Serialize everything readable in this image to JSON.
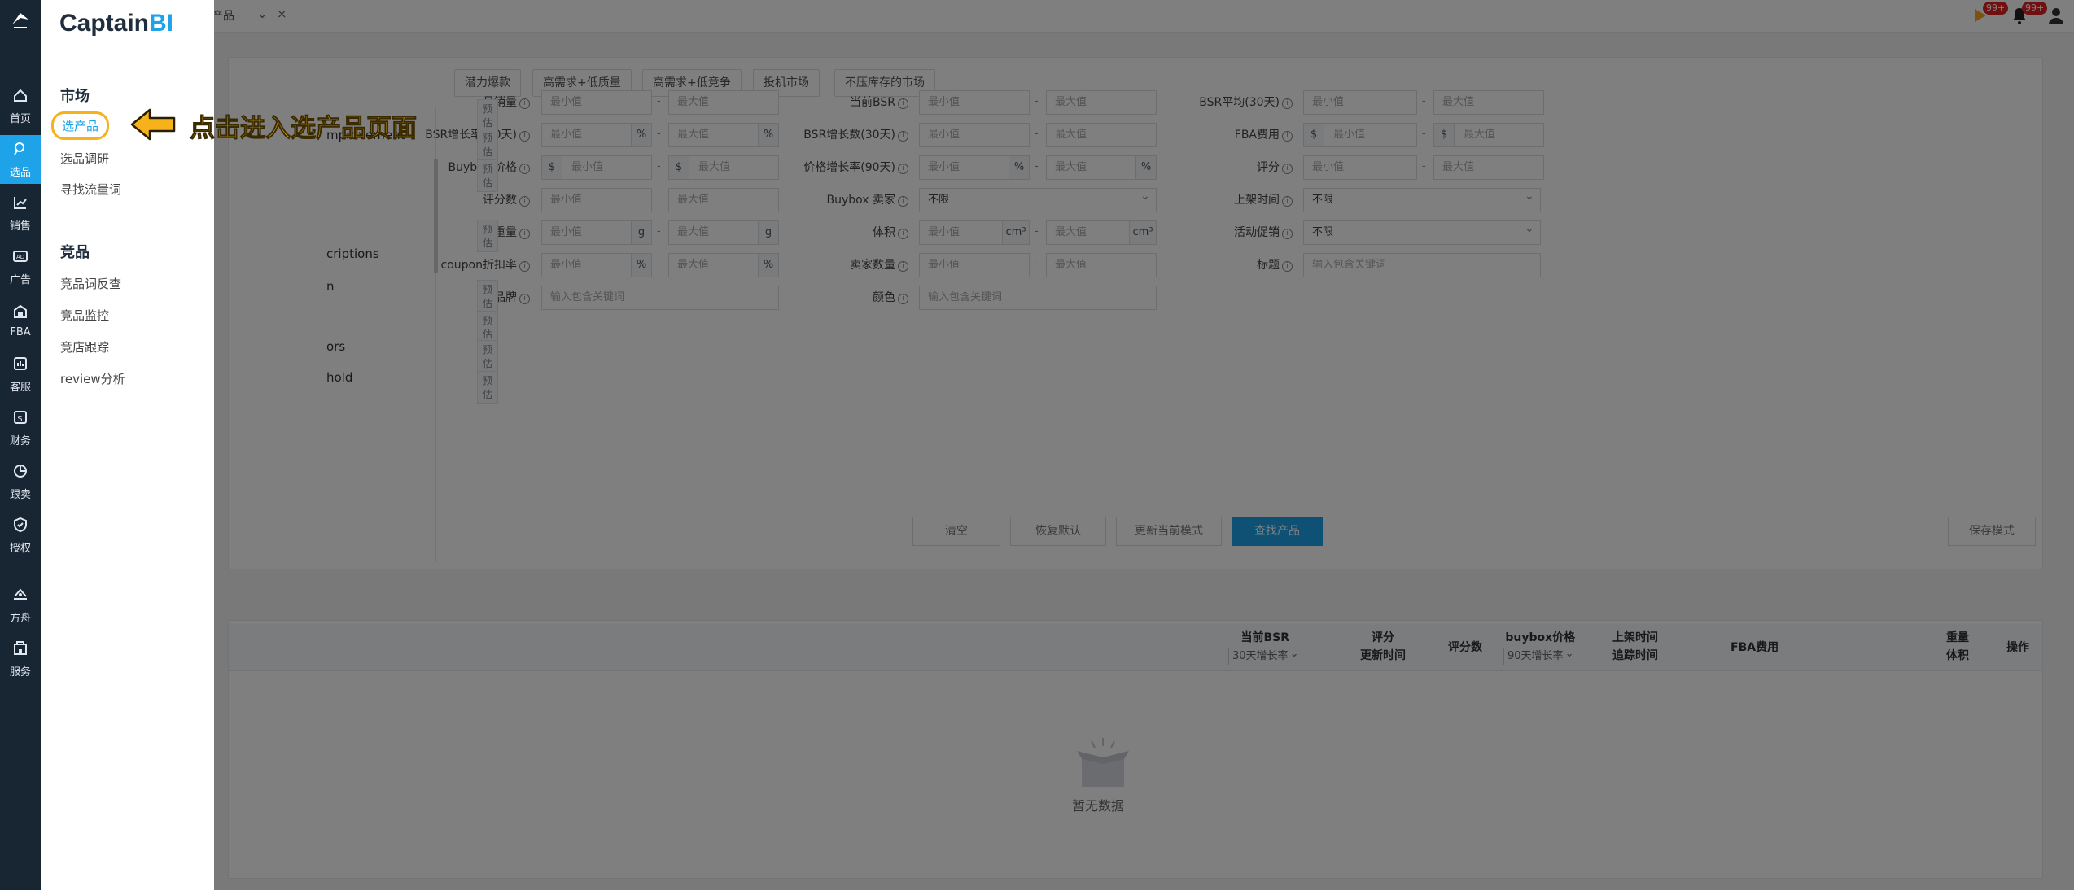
{
  "rail": {
    "items": [
      {
        "label": "首页",
        "icon": "home-icon"
      },
      {
        "label": "选品",
        "icon": "search-icon",
        "active": true
      },
      {
        "label": "销售",
        "icon": "trend-chart-icon"
      },
      {
        "label": "广告",
        "icon": "ad-icon"
      },
      {
        "label": "FBA",
        "icon": "warehouse-icon"
      },
      {
        "label": "客服",
        "icon": "chat-icon"
      },
      {
        "label": "财务",
        "icon": "dollar-icon"
      },
      {
        "label": "跟卖",
        "icon": "pie-chart-icon"
      },
      {
        "label": "授权",
        "icon": "shield-check-icon"
      },
      {
        "label": "方舟",
        "icon": "ship-icon"
      },
      {
        "label": "服务",
        "icon": "building-icon"
      }
    ]
  },
  "menu": {
    "brand_prefix": "Captain",
    "brand_suffix": "BI",
    "market_title": "市场",
    "market_items": [
      "选产品",
      "选品调研",
      "寻找流量词"
    ],
    "competitor_title": "竞品",
    "competitor_items": [
      "竞品词反查",
      "竞品监控",
      "竞店跟踪",
      "review分析"
    ]
  },
  "callout": {
    "text": "点击进入选产品页面",
    "color": "#f5b21b"
  },
  "topbar": {
    "tab_label": "产品",
    "badge_1": "99+",
    "badge_2": "99+"
  },
  "chips": [
    "潜力爆款",
    "高需求+低质量",
    "高需求+低竞争",
    "投机市场",
    "不压库存的市场"
  ],
  "filters": {
    "col1": [
      {
        "label": "月销量",
        "min": "最小值",
        "max": "最大值"
      },
      {
        "label": "BSR增长率(30天)",
        "min": "最小值",
        "max": "最大值",
        "unit": "%"
      },
      {
        "label": "Buybox 价格",
        "min": "最小值",
        "max": "最大值",
        "prefix": "$"
      },
      {
        "label": "评分数",
        "min": "最小值",
        "max": "最大值"
      },
      {
        "label": "重量",
        "min": "最小值",
        "max": "最大值",
        "unit": "g"
      },
      {
        "label": "coupon折扣率",
        "min": "最小值",
        "max": "最大值",
        "unit": "%"
      },
      {
        "label": "品牌",
        "placeholder": "输入包含关键词"
      }
    ],
    "col2": [
      {
        "label": "当前BSR",
        "min": "最小值",
        "max": "最大值"
      },
      {
        "label": "BSR增长数(30天)",
        "min": "最小值",
        "max": "最大值"
      },
      {
        "label": "价格增长率(90天)",
        "min": "最小值",
        "max": "最大值",
        "unit": "%"
      },
      {
        "label": "Buybox 卖家",
        "select": "不限"
      },
      {
        "label": "体积",
        "min": "最小值",
        "max": "最大值",
        "unit": "cm³"
      },
      {
        "label": "卖家数量",
        "min": "最小值",
        "max": "最大值"
      },
      {
        "label": "颜色",
        "placeholder": "输入包含关键词"
      }
    ],
    "col3": [
      {
        "label": "BSR平均(30天)",
        "min": "最小值",
        "max": "最大值"
      },
      {
        "label": "FBA费用",
        "min": "最小值",
        "max": "最大值",
        "prefix": "$"
      },
      {
        "label": "评分",
        "min": "最小值",
        "max": "最大值"
      },
      {
        "label": "上架时间",
        "select": "不限"
      },
      {
        "label": "活动促销",
        "select": "不限"
      },
      {
        "label": "标题",
        "placeholder": "输入包含关键词"
      }
    ]
  },
  "category_list": [
    {
      "text": "",
      "preset": "预估"
    },
    {
      "text": "mprovement",
      "preset": "预估"
    },
    {
      "text": "",
      "preset": "预估"
    },
    {
      "text": "",
      "preset": "预估"
    },
    {
      "text": "criptions",
      "preset": ""
    },
    {
      "text": "n",
      "preset": "预估"
    },
    {
      "text": "",
      "preset": "预估"
    },
    {
      "text": "ors",
      "preset": "预估"
    },
    {
      "text": "hold",
      "preset": "预估"
    }
  ],
  "buttons": {
    "clear": "清空",
    "restore": "恢复默认",
    "update_mode": "更新当前模式",
    "search": "查找产品",
    "save_mode": "保存模式"
  },
  "table": {
    "bsr": "当前BSR",
    "bsr_select": "30天增长率",
    "rating": "评分",
    "update_time": "更新时间",
    "rating_count": "评分数",
    "buybox": "buybox价格",
    "buybox_select": "90天增长率",
    "listed": "上架时间",
    "tracked": "追踪时间",
    "fba": "FBA费用",
    "weight": "重量",
    "volume": "体积",
    "action": "操作",
    "empty": "暂无数据"
  }
}
